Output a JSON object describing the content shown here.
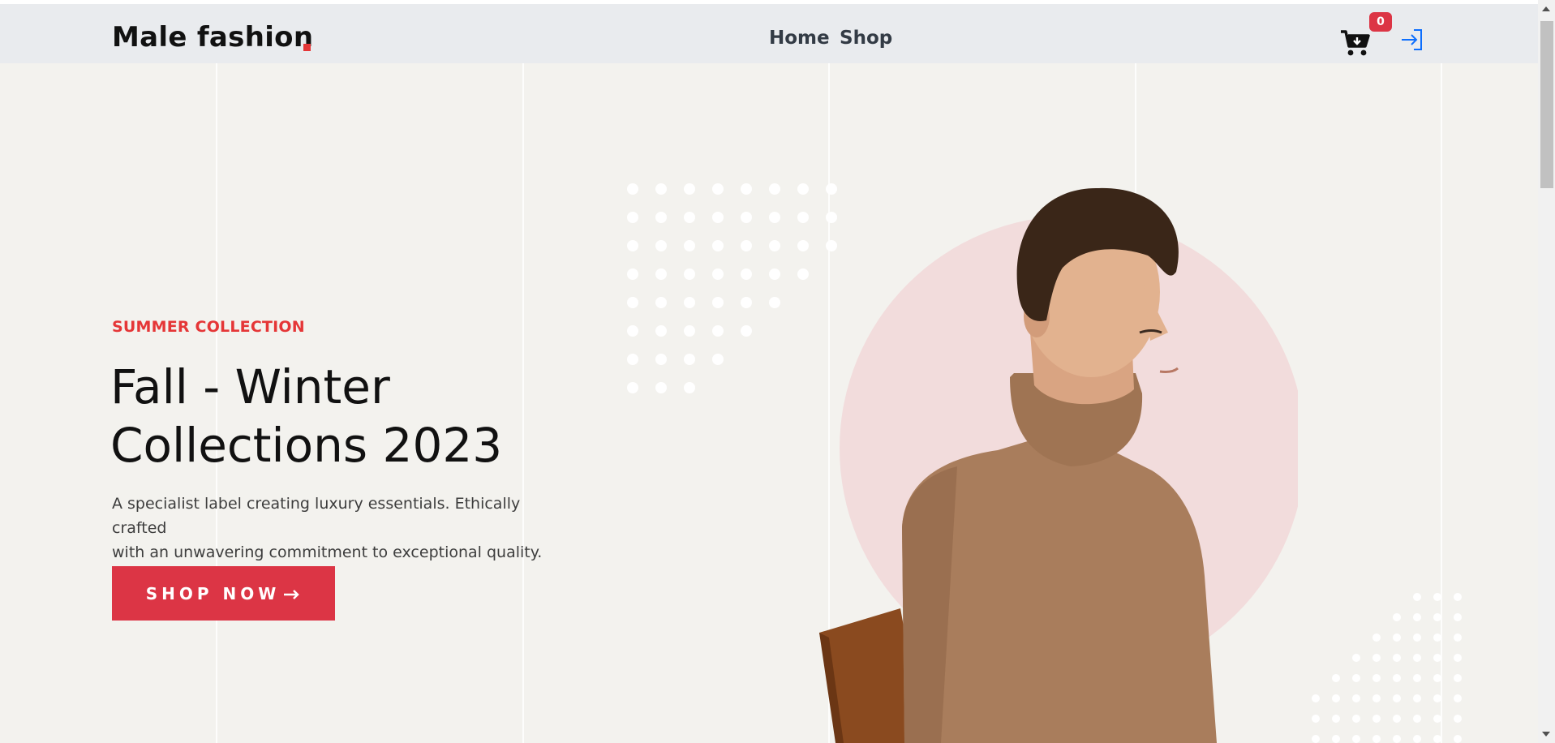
{
  "brand": {
    "name": "Male fashion",
    "accent": "#e53637"
  },
  "nav": {
    "items": [
      "Home",
      "Shop"
    ]
  },
  "header_actions": {
    "cart_icon": "cart-icon",
    "cart_count": "0",
    "login_icon": "login-icon"
  },
  "hero": {
    "label": "SUMMER COLLECTION",
    "title_line1": "Fall - Winter",
    "title_line2": "Collections 2023",
    "desc_line1": "A specialist label creating luxury essentials. Ethically crafted",
    "desc_line2": "with an unwavering commitment to exceptional quality.",
    "button_label": "SHOP NOW",
    "button_icon": "arrow-right-icon",
    "image": "model-in-turtleneck-sweater"
  },
  "colors": {
    "navbar_bg": "#e9ebee",
    "page_bg": "#f3f2ee",
    "button_bg": "#dc3545",
    "circle": "#f2dcdc",
    "login_icon": "#0d6efd"
  }
}
